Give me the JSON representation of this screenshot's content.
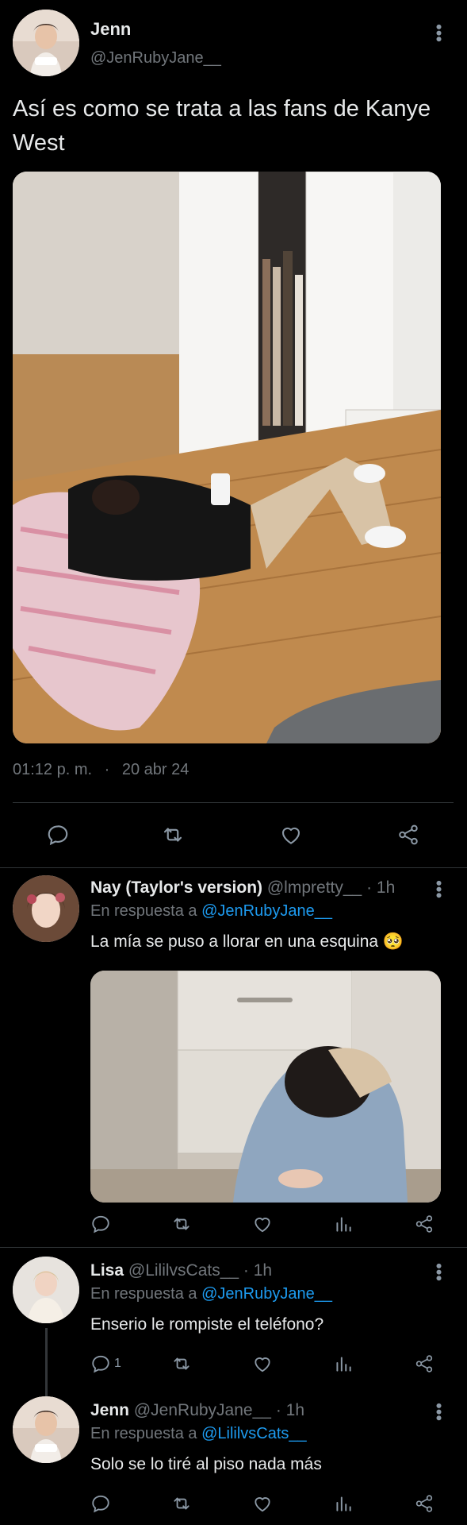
{
  "main_tweet": {
    "author_name": "Jenn",
    "author_handle": "@JenRubyJane__",
    "text": "Así es como se trata a las fans de Kanye West",
    "time": "01:12 p. m.",
    "separator": "·",
    "date": "20 abr 24"
  },
  "replies": [
    {
      "author_name": "Nay (Taylor's version)",
      "author_handle": "@lmpretty__",
      "time": "· 1h",
      "replying_prefix": "En respuesta a",
      "replying_to": "@JenRubyJane__",
      "text": "La mía se puso a llorar en una esquina 🥺"
    },
    {
      "author_name": "Lisa",
      "author_handle": "@LililvsCats__",
      "time": "· 1h",
      "replying_prefix": "En respuesta a",
      "replying_to": "@JenRubyJane__",
      "text": "Enserio le rompiste el teléfono?",
      "reply_count": "1"
    },
    {
      "author_name": "Jenn",
      "author_handle": "@JenRubyJane__",
      "time": "· 1h",
      "replying_prefix": "En respuesta a",
      "replying_to": "@LililvsCats__",
      "text": "Solo se lo tiré al piso nada más"
    }
  ],
  "icons": [
    "reply-icon",
    "retweet-icon",
    "like-icon",
    "views-icon",
    "share-icon",
    "more-icon"
  ],
  "colors": {
    "background": "#000000",
    "text": "#e7e9ea",
    "muted": "#71767b",
    "link": "#1d9bf0",
    "divider": "#2f3336"
  }
}
